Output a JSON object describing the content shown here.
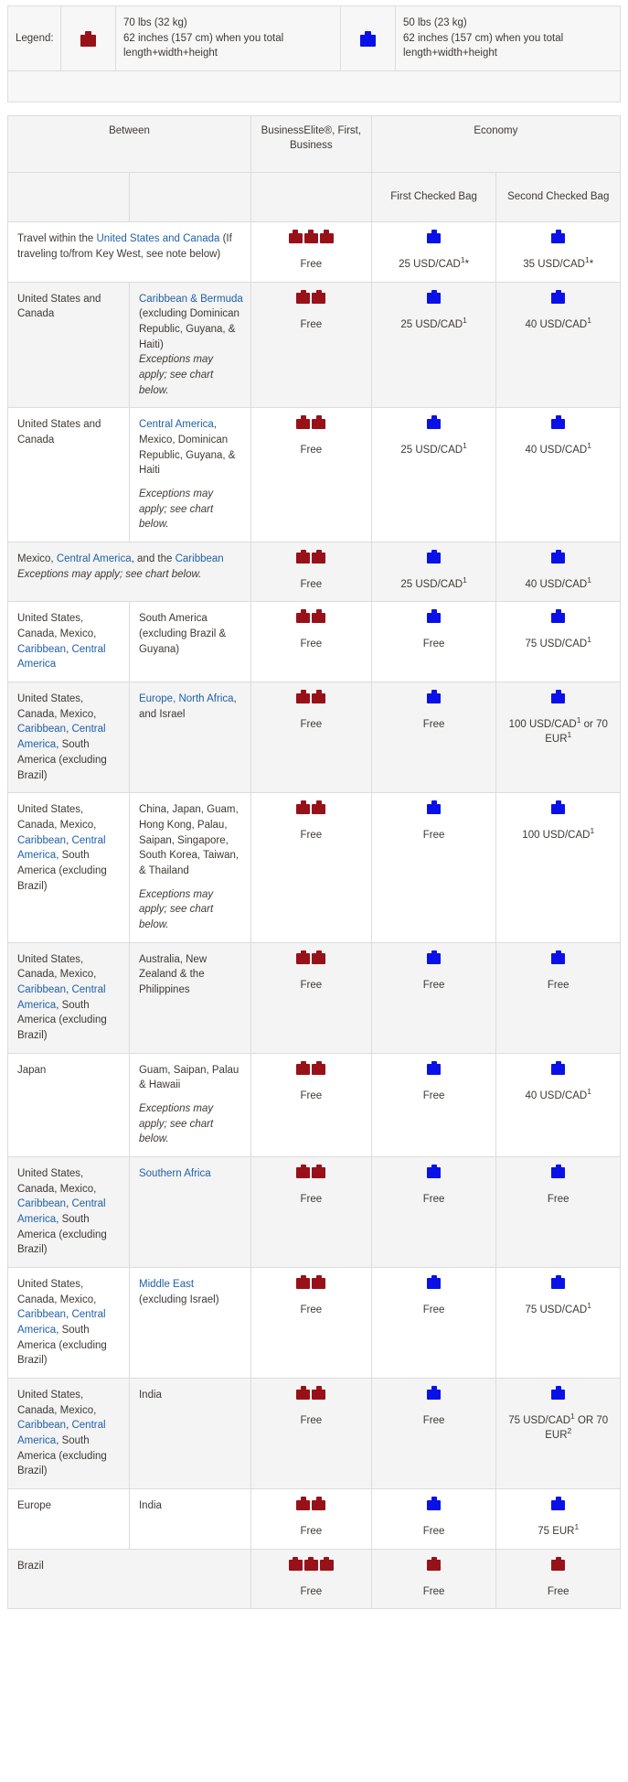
{
  "legend": {
    "label": "Legend:",
    "entries": [
      {
        "icon": "suitcase-icon-red",
        "color": "#981119",
        "line1": "70 lbs (32 kg)",
        "line2": "62 inches (157 cm) when you total",
        "line3": "length+width+height"
      },
      {
        "icon": "suitcase-icon-blue",
        "color": "#0a11e8",
        "line1": "50 lbs (23 kg)",
        "line2": "62 inches (157 cm) when you total",
        "line3": "length+width+height"
      }
    ]
  },
  "table": {
    "headers": {
      "between": "Between",
      "business": "BusinessElite®, First, Business",
      "economy": "Economy",
      "first_checked": "First Checked Bag",
      "second_checked": "Second Checked Bag"
    },
    "rows": [
      {
        "origin_parts": [
          {
            "t": "Travel within the ",
            "link": false
          },
          {
            "t": "United States and Canada",
            "link": true
          },
          {
            "t": " (If traveling to/from Key West, see note below)",
            "link": false
          }
        ],
        "destination_parts": [],
        "colspan_origin": 2,
        "red_bags": 3,
        "blue_first": 1,
        "blue_second": 1,
        "business_value": "Free",
        "first_value": "25 USD/CAD¹*",
        "second_value": "35 USD/CAD¹*",
        "zebra": false
      },
      {
        "origin_parts": [
          {
            "t": "United States and Canada",
            "link": false
          }
        ],
        "destination_parts": [
          {
            "t": "Caribbean & Bermuda",
            "link": true
          },
          {
            "t": " (excluding Dominican Republic, Guyana, & Haiti)",
            "link": false
          }
        ],
        "destination_note": "Exceptions may apply; see chart below.",
        "note_gap": false,
        "red_bags": 2,
        "blue_first": 1,
        "blue_second": 1,
        "business_value": "Free",
        "first_value": "25 USD/CAD¹",
        "second_value": "40 USD/CAD¹",
        "zebra": true
      },
      {
        "origin_parts": [
          {
            "t": "United States and Canada",
            "link": false
          }
        ],
        "destination_parts": [
          {
            "t": "Central America",
            "link": true
          },
          {
            "t": ", Mexico, Dominican Republic, Guyana, & Haiti",
            "link": false
          }
        ],
        "destination_note": "Exceptions may apply; see chart below.",
        "note_gap": true,
        "red_bags": 2,
        "blue_first": 1,
        "blue_second": 1,
        "business_value": "Free",
        "first_value": "25 USD/CAD¹",
        "second_value": "40 USD/CAD¹",
        "zebra": false
      },
      {
        "origin_parts": [
          {
            "t": "Mexico, ",
            "link": false
          },
          {
            "t": "Central America",
            "link": true
          },
          {
            "t": ", and the ",
            "link": false
          },
          {
            "t": "Caribbean",
            "link": true
          }
        ],
        "origin_note": "Exceptions may apply; see chart below.",
        "destination_parts": [],
        "colspan_origin": 2,
        "red_bags": 2,
        "blue_first": 1,
        "blue_second": 1,
        "business_value": "Free",
        "first_value": "25 USD/CAD¹",
        "second_value": "40 USD/CAD¹",
        "zebra": true
      },
      {
        "origin_parts": [
          {
            "t": "United States, Canada, Mexico, ",
            "link": false
          },
          {
            "t": "Caribbean",
            "link": true
          },
          {
            "t": ", ",
            "link": false
          },
          {
            "t": "Central America",
            "link": true
          }
        ],
        "destination_parts": [
          {
            "t": "South America (excluding Brazil & Guyana)",
            "link": false
          }
        ],
        "red_bags": 2,
        "blue_first": 1,
        "blue_second": 1,
        "business_value": "Free",
        "first_value": "Free",
        "second_value": "75 USD/CAD¹",
        "zebra": false
      },
      {
        "origin_parts": [
          {
            "t": "United States, Canada, Mexico, ",
            "link": false
          },
          {
            "t": "Caribbean",
            "link": true
          },
          {
            "t": ", ",
            "link": false
          },
          {
            "t": "Central America",
            "link": true
          },
          {
            "t": ", South America (excluding Brazil)",
            "link": false
          }
        ],
        "destination_parts": [
          {
            "t": "Europe, North Africa",
            "link": true
          },
          {
            "t": ", and Israel",
            "link": false
          }
        ],
        "red_bags": 2,
        "blue_first": 1,
        "blue_second": 1,
        "business_value": "Free",
        "first_value": "Free",
        "second_value": "100 USD/CAD¹ or 70 EUR¹",
        "zebra": true
      },
      {
        "origin_parts": [
          {
            "t": "United States, Canada, Mexico, ",
            "link": false
          },
          {
            "t": "Caribbean",
            "link": true
          },
          {
            "t": ", ",
            "link": false
          },
          {
            "t": "Central America",
            "link": true
          },
          {
            "t": ", South America (excluding Brazil)",
            "link": false
          }
        ],
        "destination_parts": [
          {
            "t": "China, Japan, Guam, Hong Kong, Palau, Saipan, Singapore, South Korea, Taiwan, & Thailand",
            "link": false
          }
        ],
        "destination_note": "Exceptions may apply; see chart below.",
        "note_gap": true,
        "red_bags": 2,
        "blue_first": 1,
        "blue_second": 1,
        "business_value": "Free",
        "first_value": "Free",
        "second_value": "100 USD/CAD¹",
        "zebra": false
      },
      {
        "origin_parts": [
          {
            "t": "United States, Canada, Mexico, ",
            "link": false
          },
          {
            "t": "Caribbean",
            "link": true
          },
          {
            "t": ", ",
            "link": false
          },
          {
            "t": "Central America",
            "link": true
          },
          {
            "t": ", South America (excluding Brazil)",
            "link": false
          }
        ],
        "destination_parts": [
          {
            "t": "Australia, New Zealand & the Philippines",
            "link": false
          }
        ],
        "red_bags": 2,
        "blue_first": 1,
        "blue_second": 1,
        "business_value": "Free",
        "first_value": "Free",
        "second_value": "Free",
        "zebra": true
      },
      {
        "origin_parts": [
          {
            "t": "Japan",
            "link": false
          }
        ],
        "destination_parts": [
          {
            "t": "Guam, Saipan, Palau & Hawaii",
            "link": false
          }
        ],
        "destination_note": "Exceptions may apply; see chart below.",
        "note_gap": true,
        "red_bags": 2,
        "blue_first": 1,
        "blue_second": 1,
        "business_value": "Free",
        "first_value": "Free",
        "second_value": "40 USD/CAD¹",
        "zebra": false
      },
      {
        "origin_parts": [
          {
            "t": "United States, Canada, Mexico, ",
            "link": false
          },
          {
            "t": "Caribbean",
            "link": true
          },
          {
            "t": ", ",
            "link": false
          },
          {
            "t": "Central America",
            "link": true
          },
          {
            "t": ", South America (excluding Brazil)",
            "link": false
          }
        ],
        "destination_parts": [
          {
            "t": "Southern Africa",
            "link": true
          }
        ],
        "red_bags": 2,
        "blue_first": 1,
        "blue_second": 1,
        "business_value": "Free",
        "first_value": "Free",
        "second_value": "Free",
        "zebra": true
      },
      {
        "origin_parts": [
          {
            "t": "United States, Canada, Mexico, ",
            "link": false
          },
          {
            "t": "Caribbean",
            "link": true
          },
          {
            "t": ", ",
            "link": false
          },
          {
            "t": "Central America",
            "link": true
          },
          {
            "t": ", South America (excluding Brazil)",
            "link": false
          }
        ],
        "destination_parts": [
          {
            "t": "Middle East",
            "link": true
          },
          {
            "t": " (excluding Israel)",
            "link": false
          }
        ],
        "red_bags": 2,
        "blue_first": 1,
        "blue_second": 1,
        "business_value": "Free",
        "first_value": "Free",
        "second_value": "75 USD/CAD¹",
        "zebra": false
      },
      {
        "origin_parts": [
          {
            "t": "United States, Canada, Mexico, ",
            "link": false
          },
          {
            "t": "Caribbean",
            "link": true
          },
          {
            "t": ", ",
            "link": false
          },
          {
            "t": "Central America",
            "link": true
          },
          {
            "t": ", South America (excluding Brazil)",
            "link": false
          }
        ],
        "destination_parts": [
          {
            "t": "India",
            "link": false
          }
        ],
        "red_bags": 2,
        "blue_first": 1,
        "blue_second": 1,
        "business_value": "Free",
        "first_value": "Free",
        "second_value": "75 USD/CAD¹ OR 70 EUR²",
        "zebra": true
      },
      {
        "origin_parts": [
          {
            "t": "Europe",
            "link": false
          }
        ],
        "destination_parts": [
          {
            "t": "India",
            "link": false
          }
        ],
        "red_bags": 2,
        "blue_first": 1,
        "blue_second": 1,
        "business_value": "Free",
        "first_value": "Free",
        "second_value": "75 EUR¹",
        "zebra": false
      },
      {
        "origin_parts": [
          {
            "t": "Brazil",
            "link": false
          }
        ],
        "destination_parts": [],
        "colspan_origin": 2,
        "red_bags": 3,
        "red_first": 1,
        "red_second": 1,
        "business_value": "Free",
        "first_value": "Free",
        "second_value": "Free",
        "zebra": true
      }
    ]
  },
  "colors": {
    "red_bag": "#981119",
    "blue_bag": "#0a11e8",
    "link": "#2061a8",
    "text": "#3d3935",
    "zebra": "#f4f4f4",
    "border": "#dcdcdc"
  }
}
